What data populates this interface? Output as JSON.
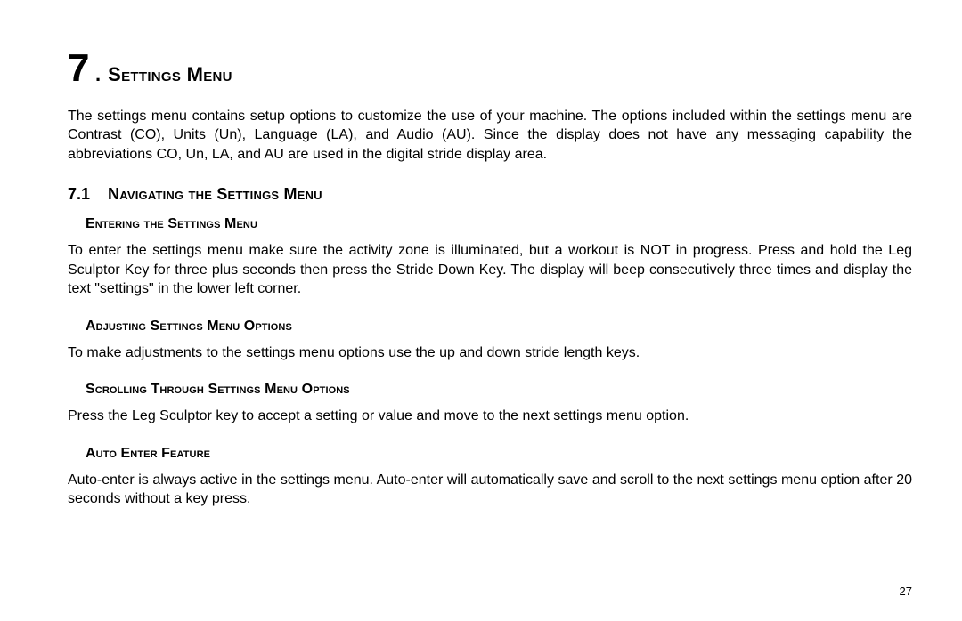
{
  "chapter": {
    "number": "7",
    "dot": ".",
    "title": "Settings Menu"
  },
  "intro": "The settings menu contains setup options to customize the use of your machine.  The options included within the settings menu are Contrast (CO), Units (Un), Language (LA), and Audio (AU).  Since the display does not have any messaging capability the abbreviations CO, Un, LA, and AU are used in the digital stride display area.",
  "section": {
    "number": "7.1",
    "title": "Navigating the Settings Menu"
  },
  "subsections": [
    {
      "title": "Entering the Settings Menu",
      "body": "To enter the settings menu make sure the activity zone is illuminated, but a workout is NOT in progress.  Press and hold the Leg Sculptor Key for three plus seconds then press the Stride Down Key. The display will beep consecutively three times and display the text \"settings\" in the lower left corner."
    },
    {
      "title": "Adjusting Settings Menu Options",
      "body": "To make adjustments to the settings menu options use the up and down stride length keys."
    },
    {
      "title": "Scrolling Through Settings Menu Options",
      "body": "Press the Leg Sculptor key to accept a setting or value and move to the next settings menu option."
    },
    {
      "title": "Auto Enter Feature",
      "body": "Auto-enter is always active in the settings menu.  Auto-enter will automatically save and scroll to the next settings menu option after 20 seconds without a key press."
    }
  ],
  "page_number": "27"
}
